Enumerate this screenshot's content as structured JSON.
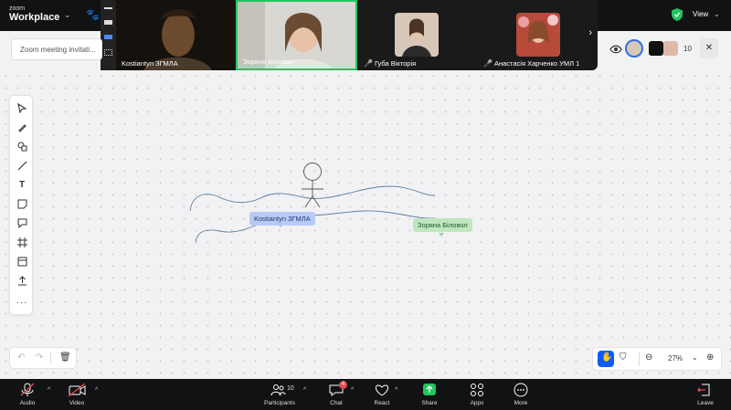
{
  "app": {
    "logo_line1": "zoom",
    "logo_line2": "Workplace",
    "view_label": "View"
  },
  "video_strip": {
    "tiles": [
      {
        "name": "Kostiantyn ЗГМЛА",
        "muted": false
      },
      {
        "name": "Зоряна Біловол",
        "muted": false,
        "active_speaker": true
      },
      {
        "name": "Губа Вікторія",
        "muted": true
      },
      {
        "name": "Анастасія Харченко УМЛ 1",
        "muted": true
      }
    ]
  },
  "doc_bar": {
    "title": "Zoom meeting invitati..."
  },
  "participants_preview": {
    "count": "10"
  },
  "toolbar": {
    "tools": [
      "select-tool",
      "pen-tool",
      "shapes-tool",
      "line-tool",
      "text-tool",
      "sticky-note-tool",
      "comment-tool",
      "frame-tool",
      "template-tool",
      "upload-tool",
      "more-tool"
    ]
  },
  "canvas": {
    "cursors": [
      {
        "name": "Kostiantyn ЗГМЛА",
        "color": "#b7cbf5"
      },
      {
        "name": "Зоряна Біловол",
        "color": "#bfe6c0"
      }
    ]
  },
  "zoom": {
    "level": "27%"
  },
  "bottom_bar": {
    "audio": "Audio",
    "video": "Video",
    "participants": "Participants",
    "participants_count": "10",
    "chat": "Chat",
    "chat_badge": "4",
    "react": "React",
    "share": "Share",
    "apps": "Apps",
    "more": "More",
    "leave": "Leave"
  },
  "colors": {
    "accent": "#0b5cff",
    "share_green": "#22c55e",
    "danger": "#e24d4d"
  }
}
